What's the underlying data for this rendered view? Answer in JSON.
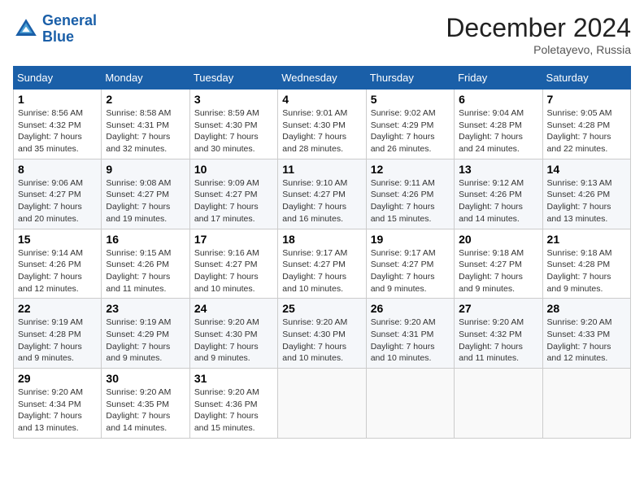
{
  "logo": {
    "line1": "General",
    "line2": "Blue"
  },
  "title": "December 2024",
  "location": "Poletayevo, Russia",
  "days_of_week": [
    "Sunday",
    "Monday",
    "Tuesday",
    "Wednesday",
    "Thursday",
    "Friday",
    "Saturday"
  ],
  "weeks": [
    [
      {
        "day": "1",
        "sunrise": "8:56 AM",
        "sunset": "4:32 PM",
        "daylight": "7 hours and 35 minutes."
      },
      {
        "day": "2",
        "sunrise": "8:58 AM",
        "sunset": "4:31 PM",
        "daylight": "7 hours and 32 minutes."
      },
      {
        "day": "3",
        "sunrise": "8:59 AM",
        "sunset": "4:30 PM",
        "daylight": "7 hours and 30 minutes."
      },
      {
        "day": "4",
        "sunrise": "9:01 AM",
        "sunset": "4:30 PM",
        "daylight": "7 hours and 28 minutes."
      },
      {
        "day": "5",
        "sunrise": "9:02 AM",
        "sunset": "4:29 PM",
        "daylight": "7 hours and 26 minutes."
      },
      {
        "day": "6",
        "sunrise": "9:04 AM",
        "sunset": "4:28 PM",
        "daylight": "7 hours and 24 minutes."
      },
      {
        "day": "7",
        "sunrise": "9:05 AM",
        "sunset": "4:28 PM",
        "daylight": "7 hours and 22 minutes."
      }
    ],
    [
      {
        "day": "8",
        "sunrise": "9:06 AM",
        "sunset": "4:27 PM",
        "daylight": "7 hours and 20 minutes."
      },
      {
        "day": "9",
        "sunrise": "9:08 AM",
        "sunset": "4:27 PM",
        "daylight": "7 hours and 19 minutes."
      },
      {
        "day": "10",
        "sunrise": "9:09 AM",
        "sunset": "4:27 PM",
        "daylight": "7 hours and 17 minutes."
      },
      {
        "day": "11",
        "sunrise": "9:10 AM",
        "sunset": "4:27 PM",
        "daylight": "7 hours and 16 minutes."
      },
      {
        "day": "12",
        "sunrise": "9:11 AM",
        "sunset": "4:26 PM",
        "daylight": "7 hours and 15 minutes."
      },
      {
        "day": "13",
        "sunrise": "9:12 AM",
        "sunset": "4:26 PM",
        "daylight": "7 hours and 14 minutes."
      },
      {
        "day": "14",
        "sunrise": "9:13 AM",
        "sunset": "4:26 PM",
        "daylight": "7 hours and 13 minutes."
      }
    ],
    [
      {
        "day": "15",
        "sunrise": "9:14 AM",
        "sunset": "4:26 PM",
        "daylight": "7 hours and 12 minutes."
      },
      {
        "day": "16",
        "sunrise": "9:15 AM",
        "sunset": "4:26 PM",
        "daylight": "7 hours and 11 minutes."
      },
      {
        "day": "17",
        "sunrise": "9:16 AM",
        "sunset": "4:27 PM",
        "daylight": "7 hours and 10 minutes."
      },
      {
        "day": "18",
        "sunrise": "9:17 AM",
        "sunset": "4:27 PM",
        "daylight": "7 hours and 10 minutes."
      },
      {
        "day": "19",
        "sunrise": "9:17 AM",
        "sunset": "4:27 PM",
        "daylight": "7 hours and 9 minutes."
      },
      {
        "day": "20",
        "sunrise": "9:18 AM",
        "sunset": "4:27 PM",
        "daylight": "7 hours and 9 minutes."
      },
      {
        "day": "21",
        "sunrise": "9:18 AM",
        "sunset": "4:28 PM",
        "daylight": "7 hours and 9 minutes."
      }
    ],
    [
      {
        "day": "22",
        "sunrise": "9:19 AM",
        "sunset": "4:28 PM",
        "daylight": "7 hours and 9 minutes."
      },
      {
        "day": "23",
        "sunrise": "9:19 AM",
        "sunset": "4:29 PM",
        "daylight": "7 hours and 9 minutes."
      },
      {
        "day": "24",
        "sunrise": "9:20 AM",
        "sunset": "4:30 PM",
        "daylight": "7 hours and 9 minutes."
      },
      {
        "day": "25",
        "sunrise": "9:20 AM",
        "sunset": "4:30 PM",
        "daylight": "7 hours and 10 minutes."
      },
      {
        "day": "26",
        "sunrise": "9:20 AM",
        "sunset": "4:31 PM",
        "daylight": "7 hours and 10 minutes."
      },
      {
        "day": "27",
        "sunrise": "9:20 AM",
        "sunset": "4:32 PM",
        "daylight": "7 hours and 11 minutes."
      },
      {
        "day": "28",
        "sunrise": "9:20 AM",
        "sunset": "4:33 PM",
        "daylight": "7 hours and 12 minutes."
      }
    ],
    [
      {
        "day": "29",
        "sunrise": "9:20 AM",
        "sunset": "4:34 PM",
        "daylight": "7 hours and 13 minutes."
      },
      {
        "day": "30",
        "sunrise": "9:20 AM",
        "sunset": "4:35 PM",
        "daylight": "7 hours and 14 minutes."
      },
      {
        "day": "31",
        "sunrise": "9:20 AM",
        "sunset": "4:36 PM",
        "daylight": "7 hours and 15 minutes."
      },
      null,
      null,
      null,
      null
    ]
  ],
  "labels": {
    "sunrise": "Sunrise:",
    "sunset": "Sunset:",
    "daylight": "Daylight:"
  }
}
